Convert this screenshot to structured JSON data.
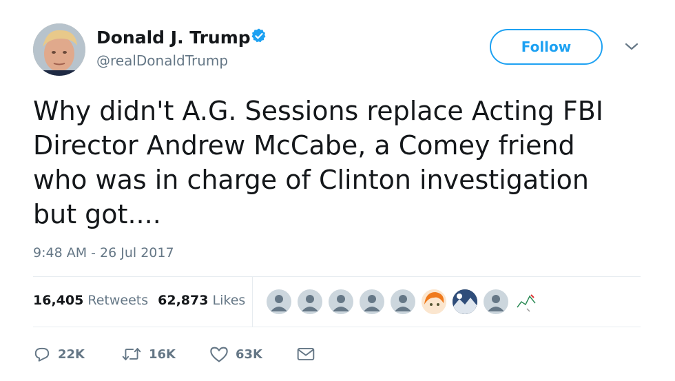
{
  "author": {
    "display_name": "Donald J. Trump",
    "handle": "@realDonaldTrump",
    "verified_icon": "verified-badge-icon"
  },
  "follow_label": "Follow",
  "tweet": {
    "lines": [
      "Why didn't A.G. Sessions replace Acting FBI",
      "Director Andrew McCabe, a Comey friend",
      "who was in charge of Clinton investigation",
      "but got...."
    ],
    "timestamp": "9:48 AM - 26 Jul 2017"
  },
  "stats": {
    "retweets_count": "16,405",
    "retweets_label": "Retweets",
    "likes_count": "62,873",
    "likes_label": "Likes"
  },
  "actions": {
    "reply_count": "22K",
    "retweet_count": "16K",
    "like_count": "63K"
  },
  "colors": {
    "accent": "#1da1f2",
    "secondary_text": "#657786",
    "primary_text": "#14171a"
  }
}
